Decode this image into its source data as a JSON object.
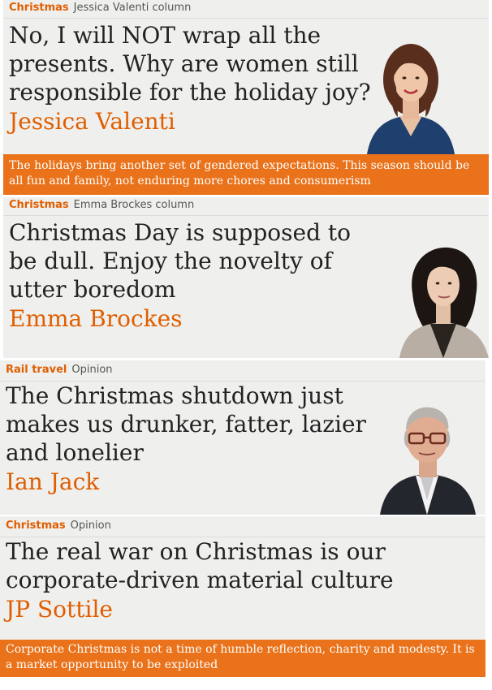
{
  "cards": [
    {
      "section": "Christmas",
      "series": "Jessica Valenti column",
      "headline": "No, I will NOT wrap all the presents. Why are women still responsible for the holiday joy?",
      "byline": "Jessica Valenti",
      "standfirst": "The holidays bring another set of gendered expectations. This season should be all fun and family, not enduring more chores and consumerism"
    },
    {
      "section": "Christmas",
      "series": "Emma Brockes column",
      "headline": "Christmas Day is supposed to be dull. Enjoy the novelty of utter boredom",
      "byline": "Emma Brockes"
    },
    {
      "section": "Rail travel",
      "series": "Opinion",
      "headline": "The Christmas shutdown just makes us drunker, fatter, lazier and lonelier",
      "byline": "Ian Jack"
    },
    {
      "section": "Christmas",
      "series": "Opinion",
      "headline": "The real war on Christmas is our corporate-driven material culture",
      "byline": "JP Sottile",
      "standfirst": "Corporate Christmas is not a time of humble reflection, charity and modesty. It is a market opportunity to be exploited"
    }
  ],
  "colors": {
    "accent": "#e05e00",
    "standfirst_bg": "#e9721a",
    "card_bg": "#efefed",
    "headline": "#222222"
  }
}
